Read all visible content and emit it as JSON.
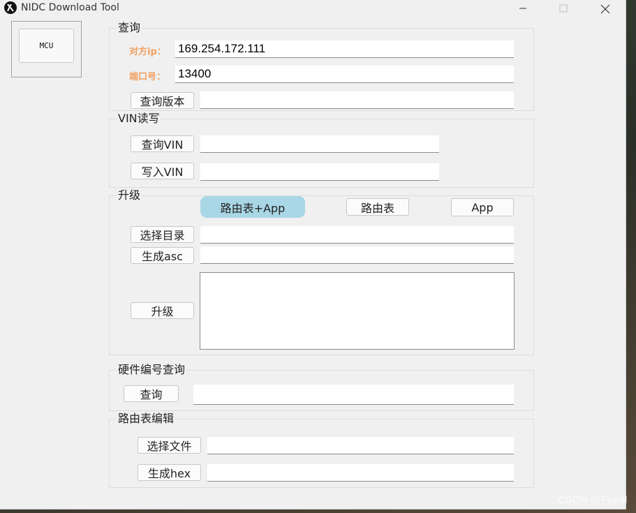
{
  "window": {
    "title": "NIDC Download Tool"
  },
  "mcu": {
    "label": "MCU"
  },
  "query": {
    "title": "查询",
    "ip_label": "对方ip：",
    "ip_value": "169.254.172.111",
    "port_label": "端口号：",
    "port_value": "13400",
    "version_button": "查询版本",
    "version_value": ""
  },
  "vin": {
    "title": "VIN读写",
    "query_button": "查询VIN",
    "query_value": "",
    "write_button": "写入VIN",
    "write_value": ""
  },
  "upgrade": {
    "title": "升级",
    "modes": [
      "路由表+App",
      "路由表",
      "App"
    ],
    "selected_mode": "路由表+App",
    "select_dir_button": "选择目录",
    "select_dir_value": "",
    "gen_asc_button": "生成asc",
    "gen_asc_value": "",
    "upgrade_button": "升级",
    "log": ""
  },
  "hardware": {
    "title": "硬件编号查询",
    "query_button": "查询",
    "query_value": ""
  },
  "routing": {
    "title": "路由表编辑",
    "select_file_button": "选择文件",
    "select_file_value": "",
    "gen_hex_button": "生成hex",
    "gen_hex_value": ""
  },
  "watermark": "CSDN @Feeal",
  "colors": {
    "selected_mode_bg": "#a9d7e6",
    "label_orange": "#f0a060"
  }
}
